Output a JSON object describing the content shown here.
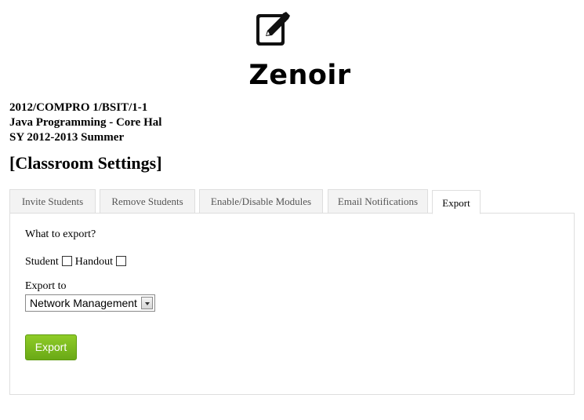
{
  "header": {
    "logo_icon": "edit-pencil-square-icon",
    "brand": "Zenoir"
  },
  "class_info": {
    "line1": "2012/COMPRO 1/BSIT/1-1",
    "line2": "Java Programming - Core Hal",
    "line3": "SY 2012-2013 Summer"
  },
  "page_title": "[Classroom Settings]",
  "tabs": [
    {
      "label": "Invite Students",
      "active": false
    },
    {
      "label": "Remove Students",
      "active": false
    },
    {
      "label": "Enable/Disable Modules",
      "active": false
    },
    {
      "label": "Email Notifications",
      "active": false
    },
    {
      "label": "Export",
      "active": true
    }
  ],
  "export_panel": {
    "question": "What to export?",
    "options": [
      {
        "label": "Student",
        "checked": false
      },
      {
        "label": "Handout",
        "checked": false
      }
    ],
    "export_to_label": "Export to",
    "export_to_value": "Network Management",
    "button_label": "Export"
  },
  "colors": {
    "button_green": "#7aba1e",
    "tab_background": "#f3f3f3",
    "border": "#dedede"
  }
}
